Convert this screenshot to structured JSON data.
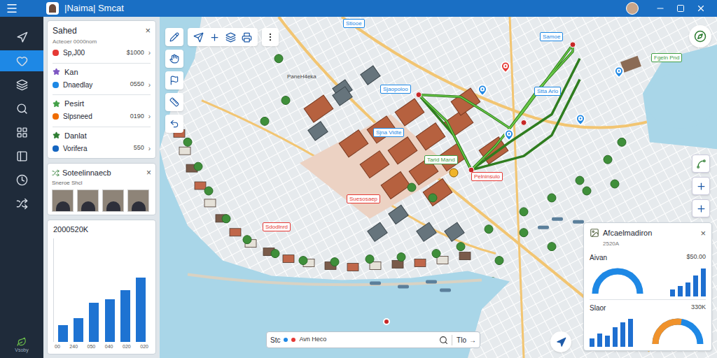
{
  "window": {
    "title": "|Naima| Smcat"
  },
  "nav": {
    "items": [
      {
        "selected": false
      },
      {
        "selected": true
      },
      {
        "selected": false
      },
      {
        "selected": false
      },
      {
        "selected": false
      },
      {
        "selected": false
      },
      {
        "selected": false
      },
      {
        "selected": false
      }
    ],
    "footer": "Vsoby"
  },
  "list_card": {
    "title": "Sahed",
    "close": "×",
    "chevron": "›",
    "rows": [
      {
        "kind": "subtitle",
        "text": "Acteoer 0000nom"
      },
      {
        "kind": "item",
        "text": "Sp,J00",
        "value": "$1000",
        "color": "#e53935"
      },
      {
        "kind": "heading",
        "text": "Kan",
        "color": "#7e57c2"
      },
      {
        "kind": "item",
        "text": "Dnaedlay",
        "value": "0550",
        "color": "#1e88e5"
      },
      {
        "kind": "heading",
        "text": "Pesirt",
        "color": "#43a047"
      },
      {
        "kind": "item",
        "text": "Slpsneed",
        "value": "0190",
        "color": "#ef6c00"
      },
      {
        "kind": "heading",
        "text": "Danlat",
        "color": "#2e7d32"
      },
      {
        "kind": "item",
        "text": "Vorifera",
        "value": "550",
        "color": "#1565c0"
      }
    ]
  },
  "photo_card": {
    "title": "Soteelinnaecb",
    "close": "×",
    "subtitle": "Sneroe Shcl",
    "photos": [
      {
        "kind": "photo"
      },
      {
        "kind": "photo"
      },
      {
        "kind": "photo"
      },
      {
        "kind": "photo"
      }
    ]
  },
  "chart_card": {
    "title": "2000520K",
    "series": [
      {
        "values": [
          30,
          42,
          70,
          76,
          92,
          115
        ]
      }
    ],
    "x_labels": [
      "00",
      "240",
      "050",
      "040",
      "020",
      "020"
    ]
  },
  "map": {
    "place_label": "PaneH4eka",
    "labels": [
      {
        "text": "Stiooe",
        "color": "#1e88e5"
      },
      {
        "text": "Samoe",
        "color": "#1e88e5"
      },
      {
        "text": "Fgeln Pnd",
        "color": "#43a047"
      },
      {
        "text": "Sjaopoloo",
        "color": "#1e88e5"
      },
      {
        "text": "Stta Arlo",
        "color": "#1e88e5"
      },
      {
        "text": "Sjna Vidte",
        "color": "#1e88e5"
      },
      {
        "text": "Tarid Mand",
        "color": "#43a047"
      },
      {
        "text": "Pelninsulo",
        "color": "#e53935"
      },
      {
        "text": "Suesosaep",
        "color": "#e53935"
      },
      {
        "text": "Sdodlnrd",
        "color": "#e53935"
      }
    ],
    "pins": [
      {
        "color": "#e53935"
      },
      {
        "color": "#1e88e5"
      },
      {
        "color": "#1e88e5"
      },
      {
        "color": "#1e88e5"
      },
      {
        "color": "#1e88e5"
      },
      {
        "color": "#c62828"
      }
    ]
  },
  "search": {
    "prefix": "Stc",
    "text": "Avn Heco",
    "button": "Tlo",
    "arrow": "→"
  },
  "info_panel": {
    "title": "Afcaelmadiron",
    "close": "×",
    "subtitle": "2520A",
    "sections": [
      {
        "kind": "gauge-left",
        "label": "Aivan",
        "value": "$50.00",
        "gauge": {
          "level": 1,
          "color": "#1e88e5",
          "track_color": "#dfe3e8"
        },
        "bars": [
          8,
          12,
          16,
          24,
          32
        ]
      },
      {
        "kind": "bars-left",
        "label": "Slaor",
        "value": "330K",
        "gauge": {
          "level": 0.55,
          "color": "#f0922b",
          "track_color": "#1e88e5"
        },
        "bars": [
          10,
          16,
          14,
          24,
          30,
          34
        ]
      }
    ]
  }
}
